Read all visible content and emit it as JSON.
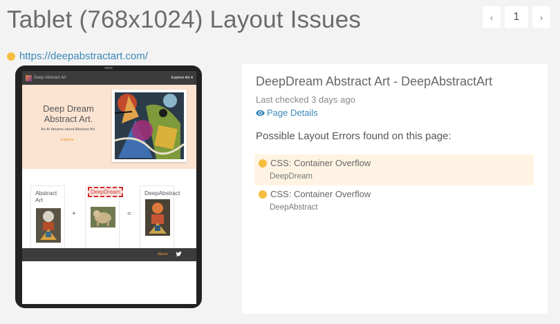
{
  "page": {
    "title": "Tablet (768x1024) Layout Issues"
  },
  "pagination": {
    "prev": "‹",
    "current": "1",
    "next": "›"
  },
  "site": {
    "url": "https://deepabstractart.com/",
    "status_color": "#f5bd41"
  },
  "preview": {
    "nav": {
      "brand": "Deep Abstract Art",
      "menu": "Explore Art ▾"
    },
    "hero": {
      "title": "Deep Dream Abstract Art.",
      "subtitle": "An AI dreams about Abstract Art",
      "button": "Explore"
    },
    "cards": [
      {
        "title": "Abstract Art"
      },
      {
        "title": "DeepDream"
      },
      {
        "title": "DeepAbstract"
      }
    ],
    "ops": {
      "plus": "+",
      "equals": "="
    },
    "footer": {
      "about": "About"
    }
  },
  "details": {
    "site_title": "DeepDream Abstract Art - DeepAbstractArt",
    "last_checked": "Last checked 3 days ago",
    "page_details": "Page Details",
    "errors_heading": "Possible Layout Errors found on this page:",
    "errors": [
      {
        "type": "CSS: Container Overflow",
        "target": "DeepDream",
        "active": true
      },
      {
        "type": "CSS: Container Overflow",
        "target": "DeepAbstract",
        "active": false
      }
    ]
  },
  "colors": {
    "accent": "#3a87b8",
    "warning": "#f5bd41",
    "error": "#d42a2a",
    "highlight": "#fff4e3"
  }
}
